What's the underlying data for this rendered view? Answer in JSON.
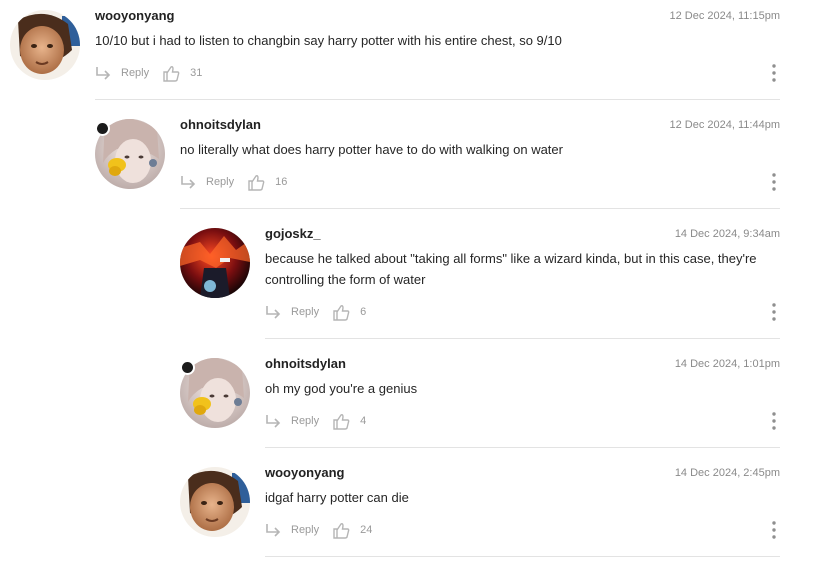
{
  "comments": [
    {
      "username": "wooyonyang",
      "timestamp": "12 Dec 2024, 11:15pm",
      "text": "10/10 but i had to listen to changbin say harry potter with his entire chest, so 9/10",
      "reply_label": "Reply",
      "likes": "31",
      "avatar": "wooyonyang-avatar",
      "online": false
    },
    {
      "username": "ohnoitsdylan",
      "timestamp": "12 Dec 2024, 11:44pm",
      "text": "no literally what does harry potter have to do with walking on water",
      "reply_label": "Reply",
      "likes": "16",
      "avatar": "ohnoitsdylan-avatar",
      "online": true
    },
    {
      "username": "gojoskz_",
      "timestamp": "14 Dec 2024, 9:34am",
      "text": "because he talked about \"taking all forms\" like a wizard kinda, but in this case, they're controlling the form of water",
      "reply_label": "Reply",
      "likes": "6",
      "avatar": "gojoskz-avatar",
      "online": false
    },
    {
      "username": "ohnoitsdylan",
      "timestamp": "14 Dec 2024, 1:01pm",
      "text": "oh my god you're a genius",
      "reply_label": "Reply",
      "likes": "4",
      "avatar": "ohnoitsdylan-avatar",
      "online": true
    },
    {
      "username": "wooyonyang",
      "timestamp": "14 Dec 2024, 2:45pm",
      "text": "idgaf harry potter can die",
      "reply_label": "Reply",
      "likes": "24",
      "avatar": "wooyonyang-avatar",
      "online": false
    }
  ],
  "colors": {
    "text": "#262626",
    "muted": "#9a9a9a",
    "divider": "#e3e3e3",
    "online_dot": "#1b1b1b"
  },
  "icons": {
    "reply": "reply-arrow-icon",
    "like": "thumbs-up-icon",
    "more": "kebab-menu-icon"
  }
}
